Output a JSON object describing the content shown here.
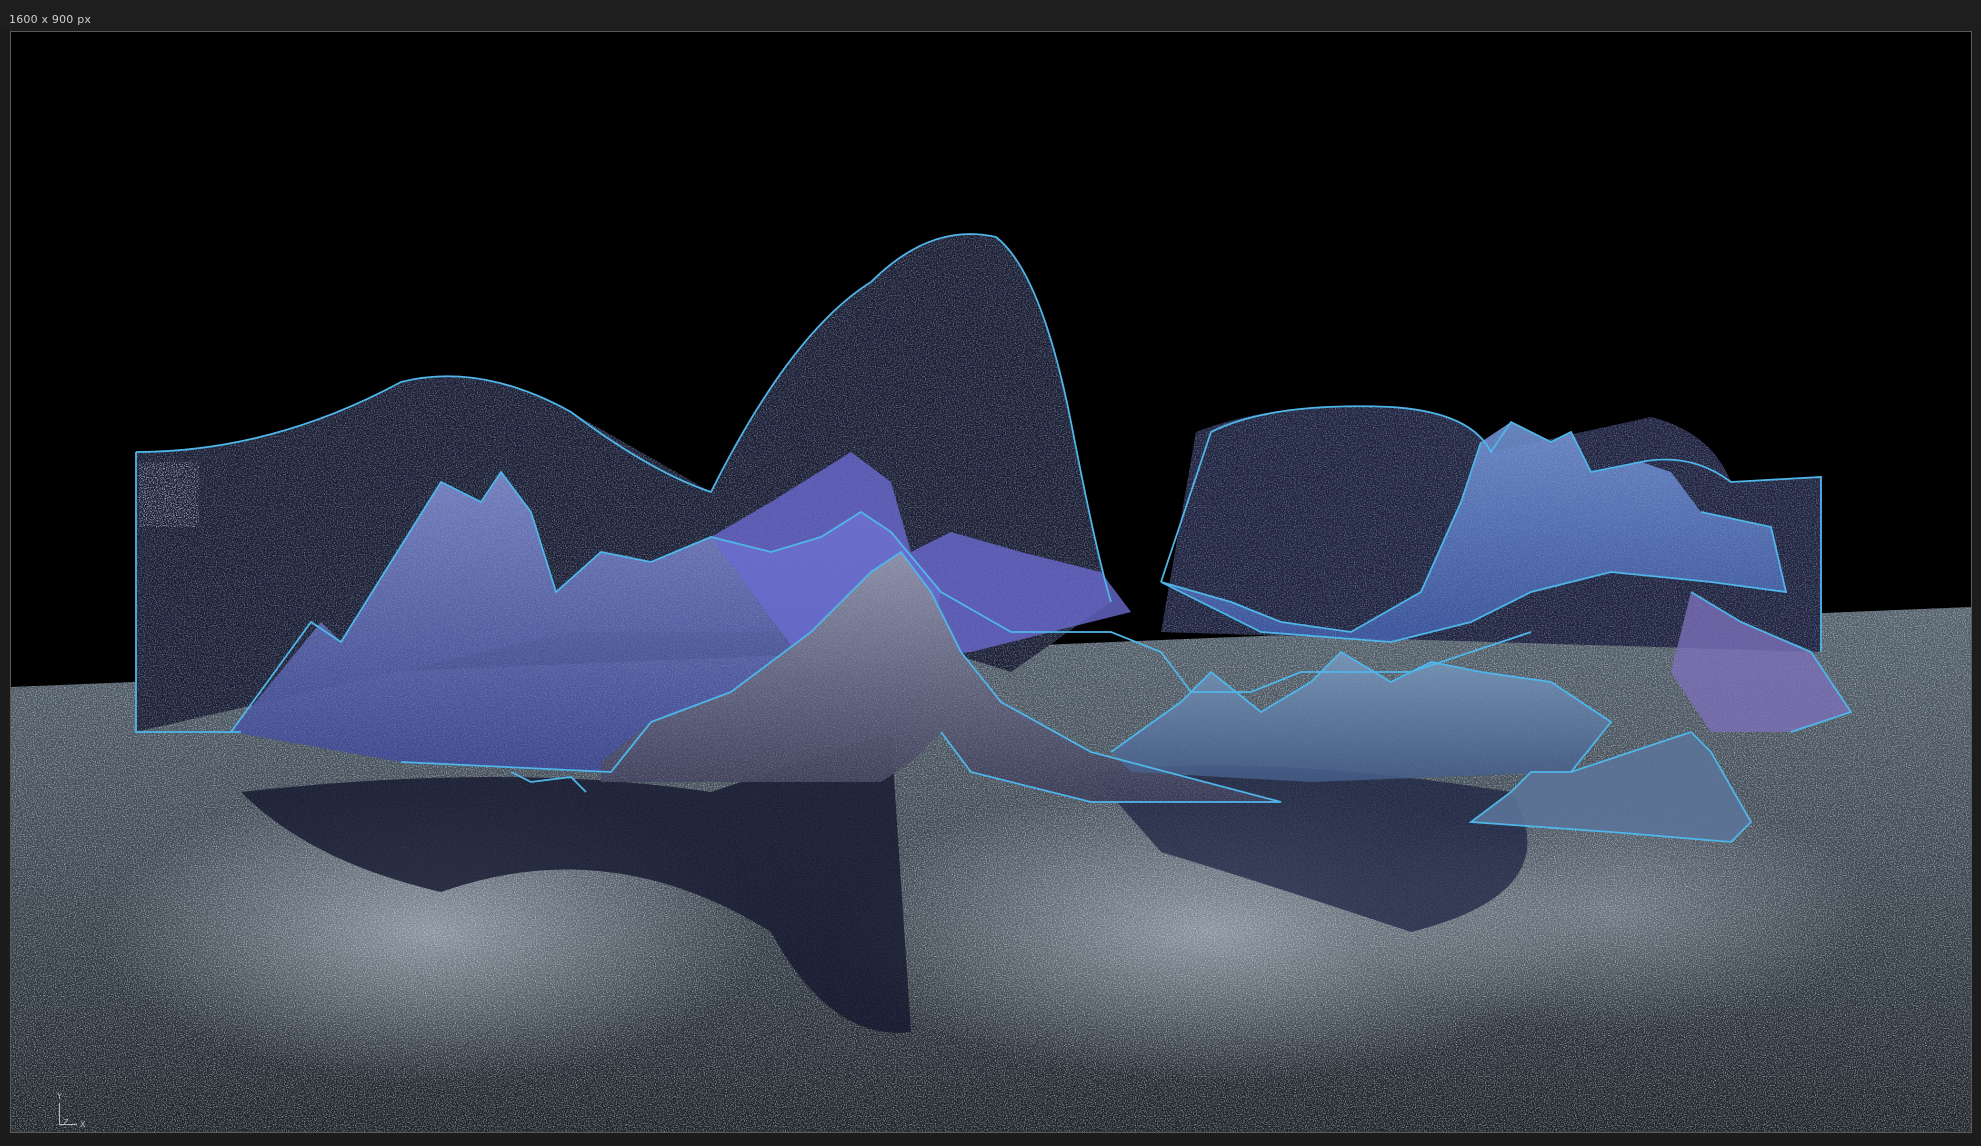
{
  "viewer": {
    "resolution_label": "1600 x 900 px"
  },
  "gizmo": {
    "y_label": "Y",
    "z_label": "Z",
    "x_label": "X"
  },
  "colors": {
    "background": "#000000",
    "frame": "#1c1c1c",
    "selection_outline": "#4fb6ea",
    "mountain_fill": "#5562a8",
    "particles": "#cfe3f2"
  }
}
